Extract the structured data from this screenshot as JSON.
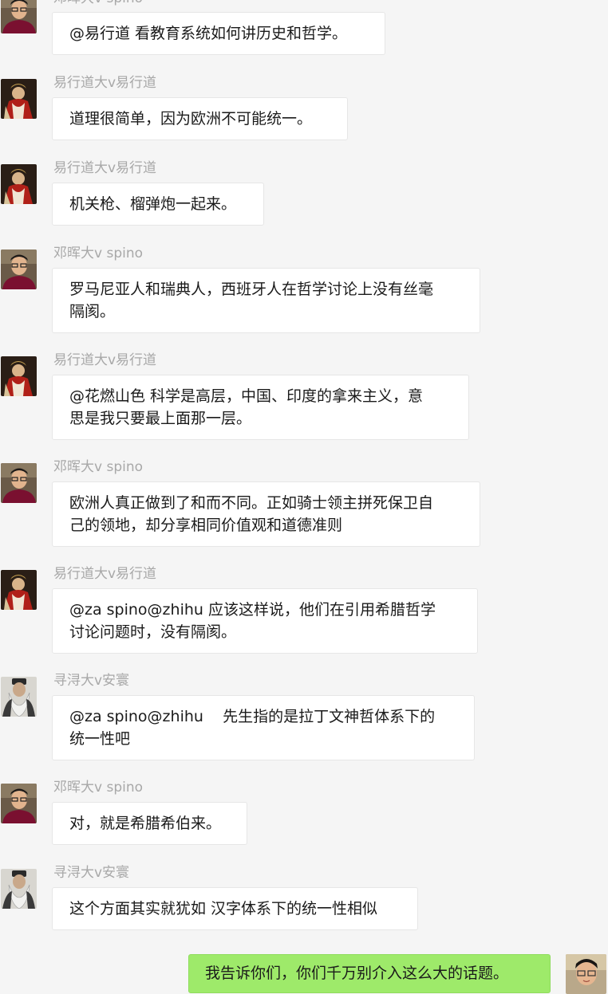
{
  "chat": {
    "messages": [
      {
        "sender": "邓晖大v spino",
        "avatar": "man-glasses-avatar",
        "lines": [
          "@易行道 看教育系统如何讲历史和哲学。"
        ]
      },
      {
        "sender": "易行道大v易行道",
        "avatar": "napoleon-portrait-avatar",
        "lines": [
          "道理很简单，因为欧洲不可能统一。"
        ]
      },
      {
        "sender": "易行道大v易行道",
        "avatar": "napoleon-portrait-avatar",
        "lines": [
          "机关枪、榴弹炮一起来。"
        ]
      },
      {
        "sender": "邓晖大v spino",
        "avatar": "man-glasses-avatar",
        "lines": [
          "罗马尼亚人和瑞典人，西班牙人在哲学讨论上没有丝毫",
          "隔阂。"
        ]
      },
      {
        "sender": "易行道大v易行道",
        "avatar": "napoleon-portrait-avatar",
        "lines": [
          "@花燃山色 科学是高层，中国、印度的拿来主义，意",
          "思是我只要最上面那一层。"
        ]
      },
      {
        "sender": "邓晖大v spino",
        "avatar": "man-glasses-avatar",
        "lines": [
          "欧洲人真正做到了和而不同。正如骑士领主拼死保卫自",
          "己的领地，却分享相同价值观和道德准则"
        ]
      },
      {
        "sender": "易行道大v易行道",
        "avatar": "napoleon-portrait-avatar",
        "lines": [
          "@za spino@zhihu 应该这样说，他们在引用希腊哲学",
          "讨论问题时，没有隔阂。"
        ]
      },
      {
        "sender": "寻浔大v安寰",
        "avatar": "bearded-sage-avatar",
        "lines": [
          "@za spino@zhihu    先生指的是拉丁文神哲体系下的",
          "统一性吧"
        ]
      },
      {
        "sender": "邓晖大v spino",
        "avatar": "man-glasses-avatar",
        "lines": [
          "对，就是希腊希伯来。"
        ]
      },
      {
        "sender": "寻浔大v安寰",
        "avatar": "bearded-sage-avatar",
        "lines": [
          "这个方面其实就犹如 汉字体系下的统一性相似"
        ]
      }
    ],
    "own_message": {
      "text": "我告诉你们，你们千万别介入这么大的话题。",
      "avatar": "self-avatar"
    }
  }
}
